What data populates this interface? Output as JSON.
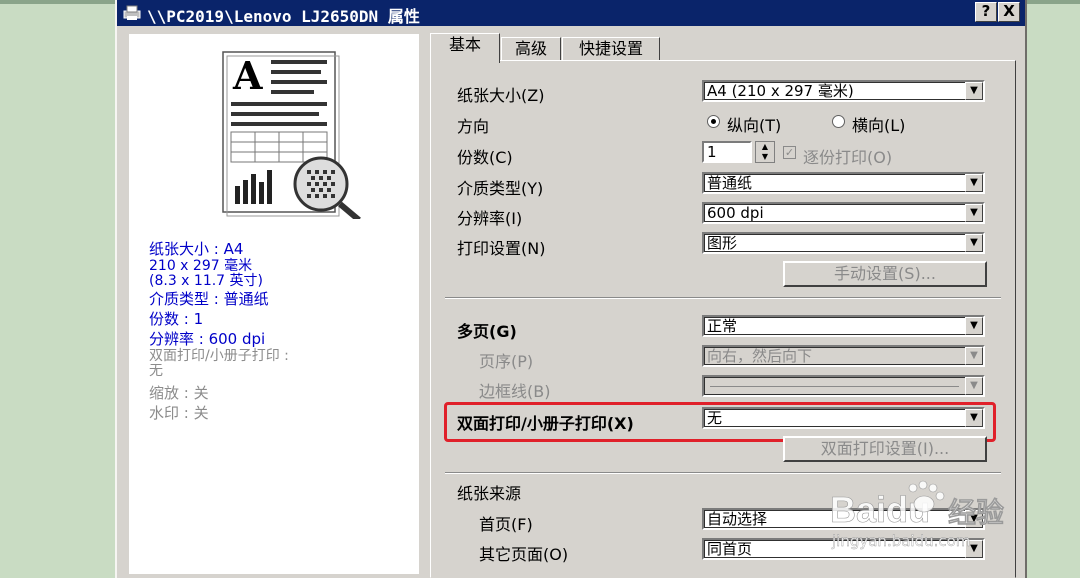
{
  "window": {
    "title": "\\\\PC2019\\Lenovo LJ2650DN 属性",
    "help_label": "?",
    "close_label": "X"
  },
  "preview": {
    "glyph": "A"
  },
  "summary": {
    "paper_size": "纸张大小 : A4",
    "dimensions_mm": "210 x 297 毫米",
    "dimensions_in": "(8.3 x 11.7 英寸)",
    "media_type": "介质类型 : 普通纸",
    "copies": "份数 : 1",
    "resolution": "分辨率 : 600 dpi",
    "duplex": "双面打印/小册子打印 :",
    "duplex_value": "无",
    "scaling": "缩放 : 关",
    "watermark": "水印 : 关"
  },
  "tabs": [
    {
      "label": "基本",
      "active": true
    },
    {
      "label": "高级",
      "active": false
    },
    {
      "label": "快捷设置",
      "active": false
    }
  ],
  "settings": {
    "paper_size_label": "纸张大小(Z)",
    "paper_size_value": "A4 (210 x 297 毫米)",
    "orientation_label": "方向",
    "portrait_label": "纵向(T)",
    "landscape_label": "横向(L)",
    "orientation_selected": "portrait",
    "copies_label": "份数(C)",
    "copies_value": "1",
    "collate_label": "逐份打印(O)",
    "media_label": "介质类型(Y)",
    "media_value": "普通纸",
    "resolution_label": "分辨率(I)",
    "resolution_value": "600 dpi",
    "print_setting_label": "打印设置(N)",
    "print_setting_value": "图形",
    "manual_setting_button": "手动设置(S)...",
    "multipage_label": "多页(G)",
    "multipage_value": "正常",
    "page_order_label": "页序(P)",
    "page_order_value": "向右，然后向下",
    "border_label": "边框线(B)",
    "border_value": "",
    "duplex_label": "双面打印/小册子打印(X)",
    "duplex_value": "无",
    "duplex_settings_button": "双面打印设置(I)...",
    "paper_source_label": "纸张来源",
    "first_page_label": "首页(F)",
    "first_page_value": "自动选择",
    "other_pages_label": "其它页面(O)",
    "other_pages_value": "同首页"
  },
  "watermark_text": {
    "brand": "Baidu",
    "suffix": "经验",
    "url": "jingyan.baidu.com"
  },
  "colors": {
    "titlebar": "#0a246a",
    "summary_text": "#0000c8",
    "highlight": "#e0202a",
    "desktop": "#c9dcc3"
  }
}
